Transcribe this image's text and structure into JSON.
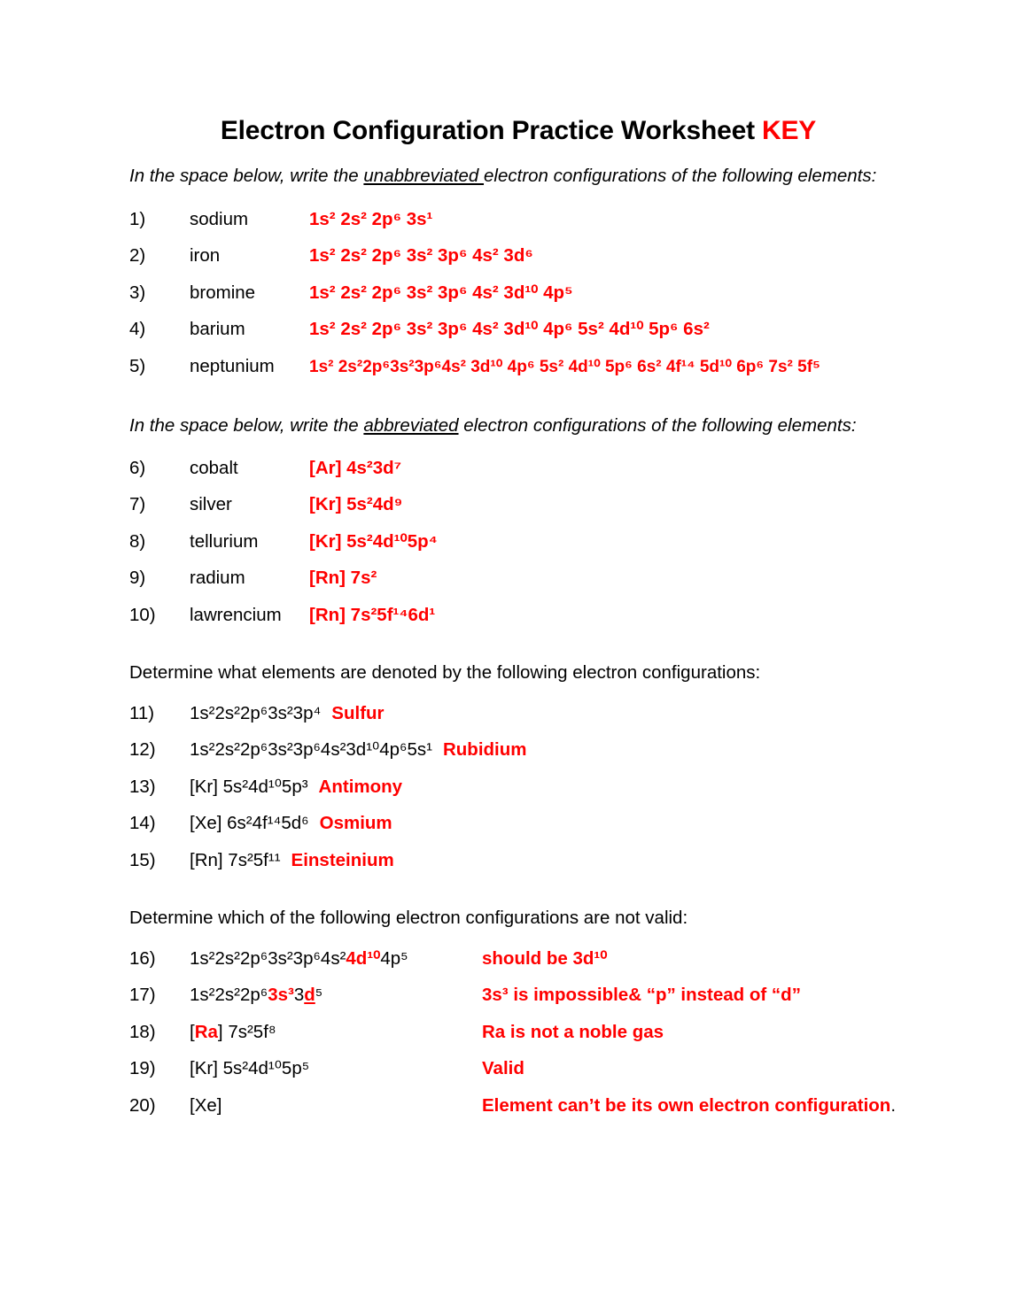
{
  "document": {
    "title_main": "Electron Configuration Practice Worksheet ",
    "title_key": "KEY"
  },
  "section1": {
    "prompt_before": "In the space below, write the ",
    "prompt_underlined": "unabbreviated ",
    "prompt_after": "electron configurations of the following elements:",
    "items": [
      {
        "num": "1)",
        "name": "sodium",
        "answer": "1s² 2s² 2p⁶ 3s¹"
      },
      {
        "num": "2)",
        "name": "iron",
        "answer": "1s² 2s² 2p⁶ 3s² 3p⁶ 4s² 3d⁶"
      },
      {
        "num": "3)",
        "name": "bromine",
        "answer": "1s² 2s² 2p⁶ 3s² 3p⁶ 4s² 3d¹⁰ 4p⁵"
      },
      {
        "num": "4)",
        "name": "barium",
        "answer": "1s² 2s² 2p⁶ 3s² 3p⁶ 4s² 3d¹⁰ 4p⁶ 5s² 4d¹⁰ 5p⁶ 6s²"
      },
      {
        "num": "5)",
        "name": "neptunium",
        "answer": "1s² 2s²2p⁶3s²3p⁶4s² 3d¹⁰ 4p⁶ 5s² 4d¹⁰ 5p⁶ 6s² 4f¹⁴ 5d¹⁰ 6p⁶ 7s² 5f⁵"
      }
    ]
  },
  "section2": {
    "prompt_before": "In the space below, write the ",
    "prompt_underlined": "abbreviated",
    "prompt_after": " electron configurations of the following elements:",
    "items": [
      {
        "num": "6)",
        "name": "cobalt",
        "answer": "[Ar]  4s²3d⁷"
      },
      {
        "num": "7)",
        "name": "silver",
        "answer": "[Kr]  5s²4d⁹"
      },
      {
        "num": "8)",
        "name": "tellurium",
        "answer": "[Kr]  5s²4d¹⁰5p⁴"
      },
      {
        "num": "9)",
        "name": "radium",
        "answer": "[Rn]  7s²"
      },
      {
        "num": "10)",
        "name": "lawrencium",
        "answer": "[Rn]  7s²5f¹⁴6d¹"
      }
    ]
  },
  "section3": {
    "prompt": "Determine what elements are denoted by the following electron configurations:",
    "items": [
      {
        "num": "11)",
        "config": "1s²2s²2p⁶3s²3p⁴",
        "answer": "Sulfur"
      },
      {
        "num": "12)",
        "config": "1s²2s²2p⁶3s²3p⁶4s²3d¹⁰4p⁶5s¹",
        "answer": "Rubidium"
      },
      {
        "num": "13)",
        "config": "[Kr] 5s²4d¹⁰5p³",
        "answer": "Antimony"
      },
      {
        "num": "14)",
        "config": "[Xe] 6s²4f¹⁴5d⁶",
        "answer": "Osmium"
      },
      {
        "num": "15)",
        "config": "[Rn]  7s²5f¹¹",
        "answer": "Einsteinium"
      }
    ]
  },
  "section4": {
    "prompt": "Determine which of the following electron configurations are not valid:",
    "items": [
      {
        "num": "16)",
        "config_black_1": "1s²2s²2p⁶3s²3p⁶4s²",
        "config_red": "4d¹⁰",
        "config_black_2": "4p⁵",
        "note": "should be 3d¹⁰"
      },
      {
        "num": "17)",
        "config_black_1": "1s²2s²2p⁶",
        "config_red": "3s³",
        "config_black_2": "3",
        "config_red_underlined": "d",
        "config_black_3": "⁵",
        "note": "3s³ is impossible& “p” instead of “d”"
      },
      {
        "num": "18)",
        "config_black_1": "[",
        "config_red": "Ra",
        "config_black_2": "] 7s²5f⁸",
        "note": "Ra is not a noble gas"
      },
      {
        "num": "19)",
        "config_black_1": "[Kr]  5s²4d¹⁰5p⁵",
        "note": "Valid"
      },
      {
        "num": "20)",
        "config_black_1": "[Xe]",
        "note": "Element can’t be its own electron configuration",
        "note_period": "."
      }
    ]
  }
}
